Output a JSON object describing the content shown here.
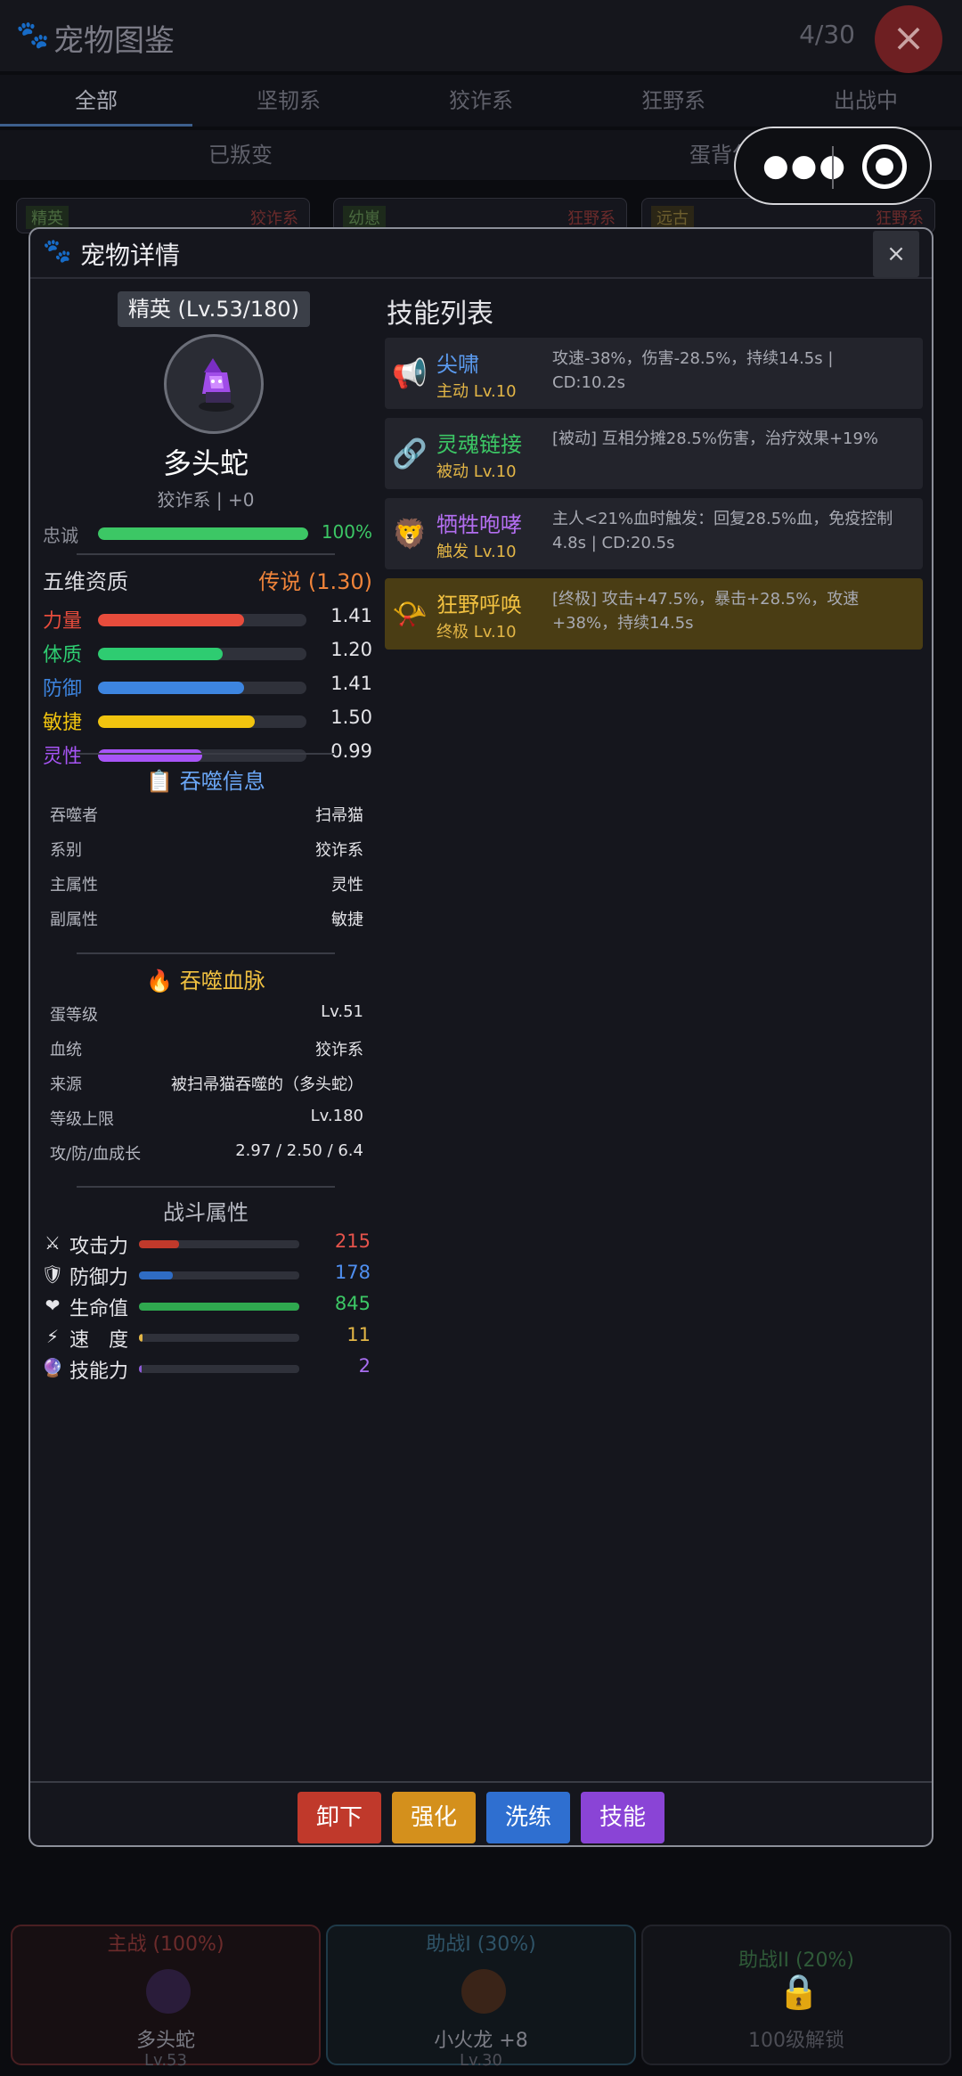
{
  "background": {
    "title": "宠物图鉴",
    "count": "4/30",
    "close_icon": "close-icon",
    "tabs": [
      "全部",
      "坚韧系",
      "狡诈系",
      "狂野系",
      "出战中"
    ],
    "subtabs": [
      "已叛变",
      "蛋背包"
    ],
    "cards": [
      {
        "tag": "精英",
        "type": "狡诈系"
      },
      {
        "tag": "幼崽",
        "type": "狂野系"
      },
      {
        "tag": "远古",
        "type": "狂野系"
      }
    ],
    "slots": [
      {
        "label": "主战 (100%)",
        "name": "多头蛇",
        "level": "Lv.53"
      },
      {
        "label": "助战I (30%)",
        "name": "小火龙 +8",
        "level": "Lv.30"
      },
      {
        "label": "助战II (20%)",
        "name": "100级解锁",
        "level": ""
      }
    ]
  },
  "modal": {
    "title": "宠物详情",
    "close_label": "×",
    "pet": {
      "rank": "精英 (Lv.53/180)",
      "name": "多头蛇",
      "subtitle": "狡诈系 | +0",
      "loyalty_label": "忠诚",
      "loyalty_value": "100%",
      "loyalty_fraction": 1.0
    },
    "aptitude": {
      "title": "五维资质",
      "grade": "传说 (1.30)",
      "rows": [
        {
          "label": "力量",
          "value": "1.41",
          "fraction": 0.7,
          "color": "#e74c3c"
        },
        {
          "label": "体质",
          "value": "1.20",
          "fraction": 0.6,
          "color": "#2ecc71"
        },
        {
          "label": "防御",
          "value": "1.41",
          "fraction": 0.7,
          "color": "#3d85e0"
        },
        {
          "label": "敏捷",
          "value": "1.50",
          "fraction": 0.75,
          "color": "#f1c40f"
        },
        {
          "label": "灵性",
          "value": "0.99",
          "fraction": 0.5,
          "color": "#a855f7"
        }
      ]
    },
    "devour_info": {
      "title": "吞噬信息",
      "icon": "clipboard-icon",
      "rows": [
        {
          "k": "吞噬者",
          "v": "扫帚猫"
        },
        {
          "k": "系别",
          "v": "狡诈系"
        },
        {
          "k": "主属性",
          "v": "灵性"
        },
        {
          "k": "副属性",
          "v": "敏捷"
        }
      ]
    },
    "bloodline": {
      "title": "吞噬血脉",
      "icon": "fire-icon",
      "rows": [
        {
          "k": "蛋等级",
          "v": "Lv.51"
        },
        {
          "k": "血统",
          "v": "狡诈系"
        },
        {
          "k": "来源",
          "v": "被扫帚猫吞噬的（多头蛇）"
        },
        {
          "k": "等级上限",
          "v": "Lv.180"
        },
        {
          "k": "攻/防/血成长",
          "v": "2.97 / 2.50 / 6.4"
        }
      ]
    },
    "combat": {
      "title": "战斗属性",
      "rows": [
        {
          "icon": "⚔",
          "icon_name": "swords-icon",
          "label": "攻击力",
          "value": "215",
          "fraction": 0.25,
          "color": "#c0392b",
          "text_color": "#e5534b"
        },
        {
          "icon": "🛡",
          "icon_name": "shield-icon",
          "label": "防御力",
          "value": "178",
          "fraction": 0.21,
          "color": "#2f6cc4",
          "text_color": "#4f8ff0"
        },
        {
          "icon": "❤",
          "icon_name": "heart-icon",
          "label": "生命值",
          "value": "845",
          "fraction": 1.0,
          "color": "#2fa84f",
          "text_color": "#3cc765"
        },
        {
          "icon": "⚡",
          "icon_name": "lightning-icon",
          "label": "速　度",
          "value": "11",
          "fraction": 0.02,
          "color": "#e3b646",
          "text_color": "#e3b646"
        },
        {
          "icon": "🔮",
          "icon_name": "crystal-ball-icon",
          "label": "技能力",
          "value": "2",
          "fraction": 0.01,
          "color": "#8e5bd8",
          "text_color": "#a86ef0"
        }
      ]
    },
    "skills": {
      "title": "技能列表",
      "items": [
        {
          "icon": "📢",
          "icon_name": "megaphone-icon",
          "name": "尖啸",
          "name_color": "#5b9bf0",
          "level": "主动 Lv.10",
          "desc": "攻速-38%，伤害-28.5%，持续14.5s | CD:10.2s",
          "ultimate": false
        },
        {
          "icon": "🔗",
          "icon_name": "link-icon",
          "name": "灵魂链接",
          "name_color": "#3cc765",
          "level": "被动 Lv.10",
          "desc": "[被动] 互相分摊28.5%伤害，治疗效果+19%",
          "ultimate": false
        },
        {
          "icon": "🦁",
          "icon_name": "lion-icon",
          "name": "牺牲咆哮",
          "name_color": "#b36ef0",
          "level": "触发 Lv.10",
          "desc": "主人<21%血时触发：回复28.5%血，免疫控制4.8s | CD:20.5s",
          "ultimate": false
        },
        {
          "icon": "📯",
          "icon_name": "horn-icon",
          "name": "狂野呼唤",
          "name_color": "#f0c040",
          "level": "终极 Lv.10",
          "desc": "[终极] 攻击+47.5%，暴击+28.5%，攻速+38%，持续14.5s",
          "ultimate": true
        }
      ]
    },
    "buttons": [
      {
        "label": "卸下",
        "color": "#c0392b"
      },
      {
        "label": "强化",
        "color": "#d4901c"
      },
      {
        "label": "洗练",
        "color": "#2f6fd0"
      },
      {
        "label": "技能",
        "color": "#8a44d6"
      }
    ]
  }
}
